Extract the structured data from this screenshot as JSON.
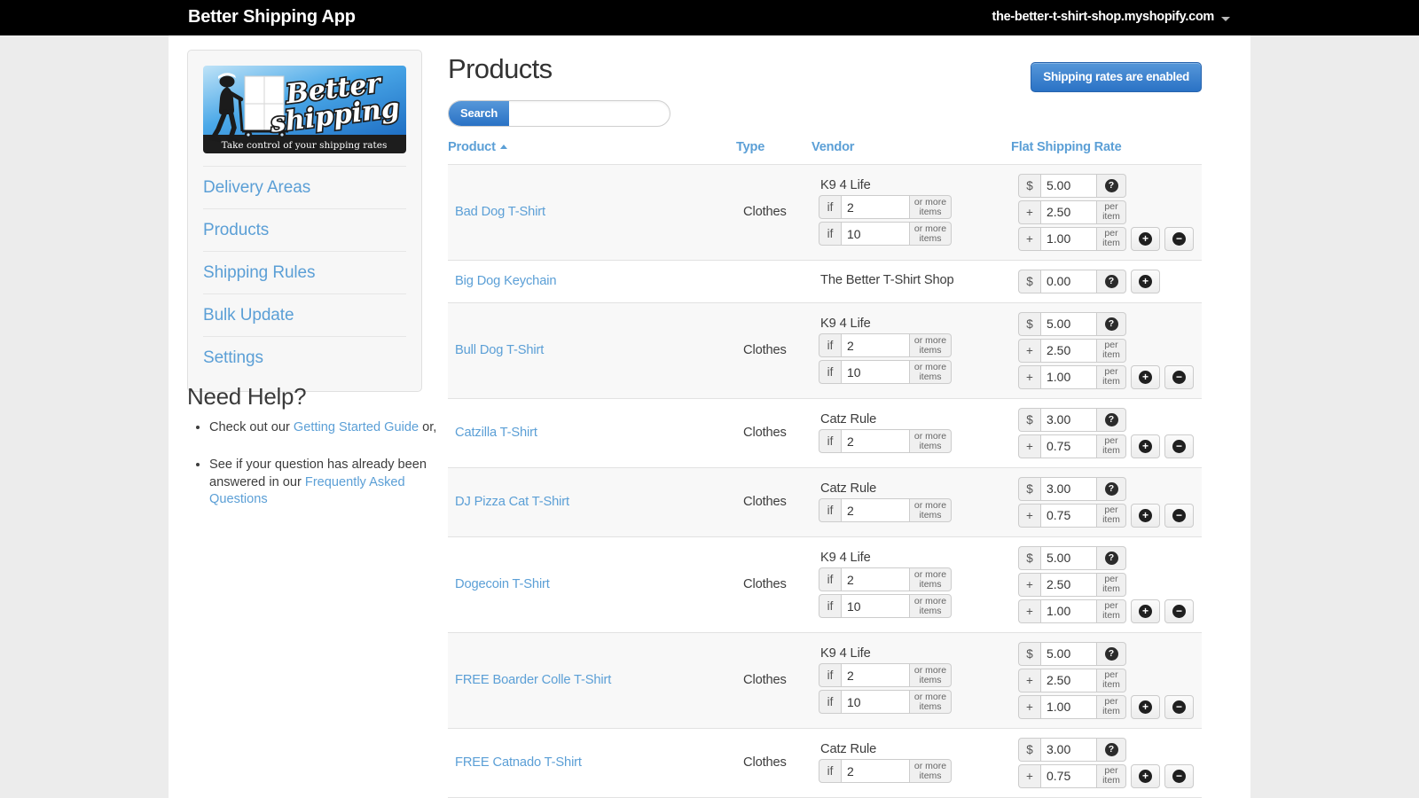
{
  "topbar": {
    "app_title": "Better Shipping App",
    "shop_domain": "the-better-t-shirt-shop.myshopify.com"
  },
  "sidebar": {
    "logo": {
      "brand_line1": "Better",
      "brand_line2": "shipping",
      "tagline": "Take control of your shipping rates"
    },
    "items": [
      {
        "label": "Delivery Areas"
      },
      {
        "label": "Products"
      },
      {
        "label": "Shipping Rules"
      },
      {
        "label": "Bulk Update"
      },
      {
        "label": "Settings"
      }
    ]
  },
  "help": {
    "heading": "Need Help?",
    "item1_prefix": "Check out our ",
    "item1_link": "Getting Started Guide",
    "item1_suffix": " or,",
    "item2_prefix": "See if your question has already been answered in our ",
    "item2_link": "Frequently Asked Questions"
  },
  "main": {
    "page_title": "Products",
    "status_button": "Shipping rates are enabled",
    "search": {
      "button_label": "Search",
      "value": "",
      "placeholder": ""
    },
    "columns": {
      "product": "Product",
      "type": "Type",
      "vendor": "Vendor",
      "rate": "Flat Shipping Rate"
    },
    "sort": {
      "column": "Product",
      "direction": "asc"
    },
    "labels": {
      "if": "if",
      "or_more_items": "or more items",
      "dollar": "$",
      "plus": "+",
      "per_item": "per item",
      "help_glyph": "?",
      "add_glyph": "+",
      "remove_glyph": "−"
    },
    "rows": [
      {
        "product": "Bad Dog T-Shirt",
        "type": "Clothes",
        "vendor": "K9 4 Life",
        "tiers": [
          {
            "qty": "2"
          },
          {
            "qty": "10"
          }
        ],
        "base_rate": "5.00",
        "extra_rates": [
          "2.50",
          "1.00"
        ],
        "has_add": true,
        "has_remove": true,
        "shaded": true
      },
      {
        "product": "Big Dog Keychain",
        "type": "",
        "vendor": "The Better T-Shirt Shop",
        "tiers": [],
        "base_rate": "0.00",
        "extra_rates": [],
        "has_add": true,
        "has_remove": false,
        "shaded": false
      },
      {
        "product": "Bull Dog T-Shirt",
        "type": "Clothes",
        "vendor": "K9 4 Life",
        "tiers": [
          {
            "qty": "2"
          },
          {
            "qty": "10"
          }
        ],
        "base_rate": "5.00",
        "extra_rates": [
          "2.50",
          "1.00"
        ],
        "has_add": true,
        "has_remove": true,
        "shaded": true
      },
      {
        "product": "Catzilla T-Shirt",
        "type": "Clothes",
        "vendor": "Catz Rule",
        "tiers": [
          {
            "qty": "2"
          }
        ],
        "base_rate": "3.00",
        "extra_rates": [
          "0.75"
        ],
        "has_add": true,
        "has_remove": true,
        "shaded": false
      },
      {
        "product": "DJ Pizza Cat T-Shirt",
        "type": "Clothes",
        "vendor": "Catz Rule",
        "tiers": [
          {
            "qty": "2"
          }
        ],
        "base_rate": "3.00",
        "extra_rates": [
          "0.75"
        ],
        "has_add": true,
        "has_remove": true,
        "shaded": true
      },
      {
        "product": "Dogecoin T-Shirt",
        "type": "Clothes",
        "vendor": "K9 4 Life",
        "tiers": [
          {
            "qty": "2"
          },
          {
            "qty": "10"
          }
        ],
        "base_rate": "5.00",
        "extra_rates": [
          "2.50",
          "1.00"
        ],
        "has_add": true,
        "has_remove": true,
        "shaded": false
      },
      {
        "product": "FREE Boarder Colle T-Shirt",
        "type": "Clothes",
        "vendor": "K9 4 Life",
        "tiers": [
          {
            "qty": "2"
          },
          {
            "qty": "10"
          }
        ],
        "base_rate": "5.00",
        "extra_rates": [
          "2.50",
          "1.00"
        ],
        "has_add": true,
        "has_remove": true,
        "shaded": true
      },
      {
        "product": "FREE Catnado T-Shirt",
        "type": "Clothes",
        "vendor": "Catz Rule",
        "tiers": [
          {
            "qty": "2"
          }
        ],
        "base_rate": "3.00",
        "extra_rates": [
          "0.75"
        ],
        "has_add": true,
        "has_remove": true,
        "shaded": false
      }
    ]
  },
  "colors": {
    "accent_blue": "#5b9fd6",
    "button_blue": "#2a72c5",
    "topbar_black": "#000000",
    "page_bg": "#ececec",
    "row_alt": "#f8f8f8"
  }
}
